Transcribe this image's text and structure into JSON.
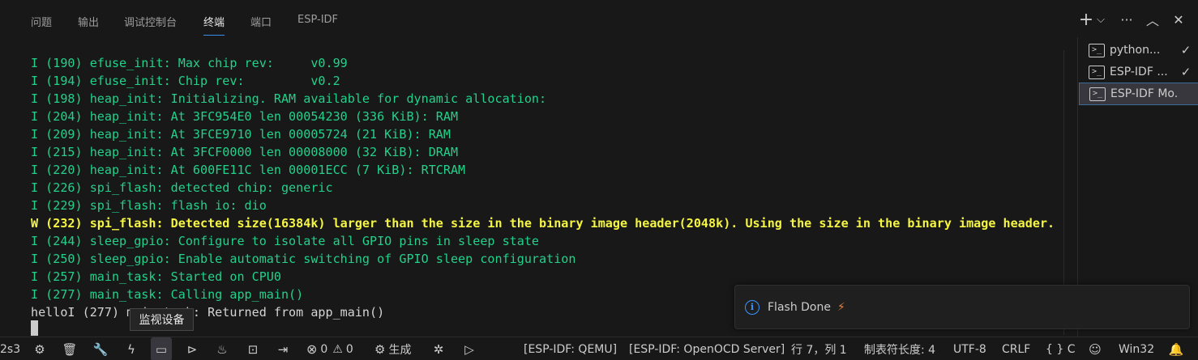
{
  "panel": {
    "tabs": [
      {
        "label": "问题"
      },
      {
        "label": "输出"
      },
      {
        "label": "调试控制台"
      },
      {
        "label": "终端"
      },
      {
        "label": "端口"
      },
      {
        "label": "ESP-IDF"
      }
    ],
    "active_tab": "终端",
    "actions": {
      "new_terminal": "+",
      "dropdown": "⌵",
      "more": "···",
      "maximize": "︿",
      "close": "✕"
    }
  },
  "terminal": {
    "lines": [
      {
        "level": "info",
        "text": "I (190) efuse_init: Max chip rev:     v0.99"
      },
      {
        "level": "info",
        "text": "I (194) efuse_init: Chip rev:         v0.2"
      },
      {
        "level": "info",
        "text": "I (198) heap_init: Initializing. RAM available for dynamic allocation:"
      },
      {
        "level": "info",
        "text": "I (204) heap_init: At 3FC954E0 len 00054230 (336 KiB): RAM"
      },
      {
        "level": "info",
        "text": "I (209) heap_init: At 3FCE9710 len 00005724 (21 KiB): RAM"
      },
      {
        "level": "info",
        "text": "I (215) heap_init: At 3FCF0000 len 00008000 (32 KiB): DRAM"
      },
      {
        "level": "info",
        "text": "I (220) heap_init: At 600FE11C len 00001ECC (7 KiB): RTCRAM"
      },
      {
        "level": "info",
        "text": "I (226) spi_flash: detected chip: generic"
      },
      {
        "level": "info",
        "text": "I (229) spi_flash: flash io: dio"
      },
      {
        "level": "warn",
        "text": "W (232) spi_flash: Detected size(16384k) larger than the size in the binary image header(2048k). Using the size in the binary image header."
      },
      {
        "level": "info",
        "text": "I (244) sleep_gpio: Configure to isolate all GPIO pins in sleep state"
      },
      {
        "level": "info",
        "text": "I (250) sleep_gpio: Enable automatic switching of GPIO sleep configuration"
      },
      {
        "level": "info",
        "text": "I (257) main_task: Started on CPU0"
      },
      {
        "level": "info",
        "text": "I (277) main_task: Calling app_main()"
      },
      {
        "level": "plain",
        "text": "helloI (277) main_task: Returned from app_main()"
      }
    ]
  },
  "terminal_list": [
    {
      "icon": ">_",
      "label": "python...",
      "status": "✓",
      "selected": false
    },
    {
      "icon": ">_",
      "label": "ESP-IDF ...",
      "status": "✓",
      "selected": false
    },
    {
      "icon": ">_",
      "label": "ESP-IDF Mo...",
      "status": "",
      "selected": true
    }
  ],
  "notification": {
    "icon": "i",
    "message": "Flash Done",
    "emoji": "⚡"
  },
  "tooltip": {
    "text": "监视设备"
  },
  "statusbar": {
    "target": "2s3",
    "icons": [
      {
        "name": "gear-icon",
        "glyph": "⚙"
      },
      {
        "name": "trash-icon",
        "glyph": "🗑"
      },
      {
        "name": "wrench-icon",
        "glyph": "🔧"
      },
      {
        "name": "flash-icon",
        "glyph": "ϟ"
      },
      {
        "name": "monitor-icon",
        "glyph": "▭"
      },
      {
        "name": "debug-flash-icon",
        "glyph": "⊳"
      },
      {
        "name": "fire-icon",
        "glyph": "♨"
      },
      {
        "name": "terminal-icon",
        "glyph": "⊡"
      },
      {
        "name": "enter-icon",
        "glyph": "⇥"
      }
    ],
    "errors_icon": "⊗",
    "errors": "0",
    "warnings_icon": "⚠",
    "warnings": "0",
    "build_icon": "⚙",
    "build_label": "生成",
    "debug_icon": "✲",
    "run_icon": "▷",
    "qemu": "[ESP-IDF: QEMU]",
    "openocd": "[ESP-IDF: OpenOCD Server]",
    "cursor_pos": "行 7，列 1",
    "tab_size": "制表符长度: 4",
    "encoding": "UTF-8",
    "eol": "CRLF",
    "language": "{ } C",
    "copilot_icon": "☺",
    "platform": "Win32",
    "bell_icon": "🔔"
  }
}
